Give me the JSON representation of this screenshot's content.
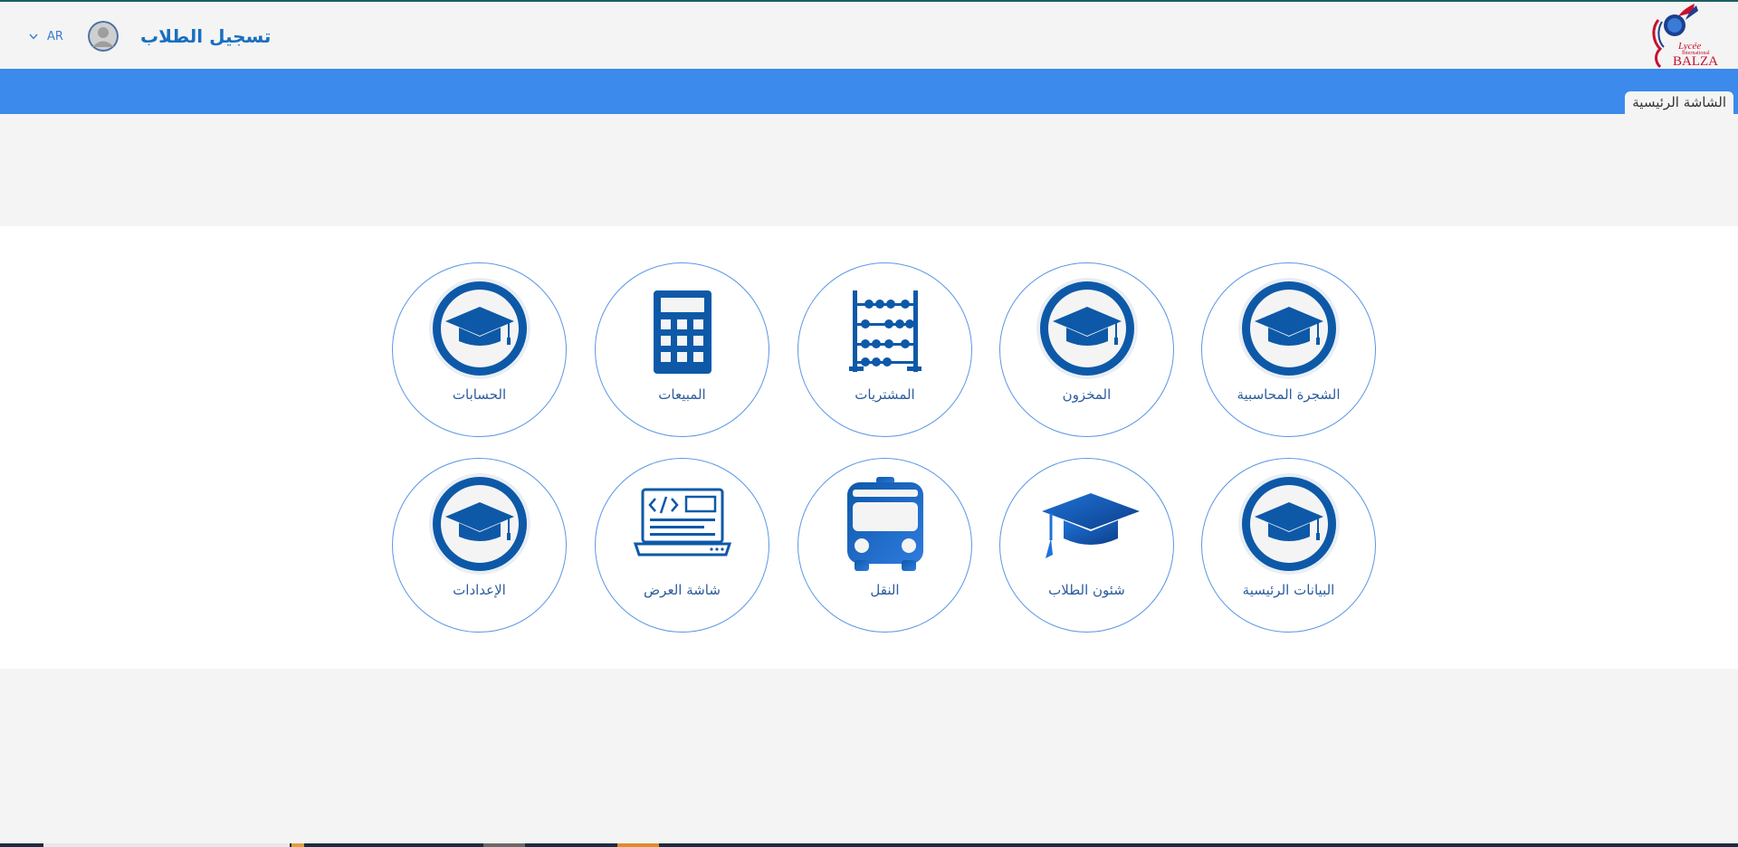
{
  "header": {
    "language": "AR",
    "title": "تسجيل الطلاب",
    "logo_text_top": "Lycée",
    "logo_text_mid": "International",
    "logo_text_main": "BALZAC"
  },
  "nav": {
    "home_tab": "الشاشة الرئيسية"
  },
  "tiles": [
    {
      "label": "الشجرة المحاسبية",
      "icon": "graduation-cap-badge-icon"
    },
    {
      "label": "المخزون",
      "icon": "graduation-cap-badge-icon"
    },
    {
      "label": "المشتريات",
      "icon": "abacus-icon"
    },
    {
      "label": "المبيعات",
      "icon": "calculator-icon"
    },
    {
      "label": "الحسابات",
      "icon": "graduation-cap-badge-icon"
    },
    {
      "label": "البيانات الرئيسية",
      "icon": "graduation-cap-badge-icon"
    },
    {
      "label": "شئون الطلاب",
      "icon": "graduation-cap-icon"
    },
    {
      "label": "النقل",
      "icon": "bus-icon"
    },
    {
      "label": "شاشة العرض",
      "icon": "laptop-code-icon"
    },
    {
      "label": "الإعدادات",
      "icon": "graduation-cap-badge-icon"
    }
  ],
  "colors": {
    "accent_blue": "#3b8aec",
    "icon_blue": "#0d59a8",
    "title_blue": "#1a6fc0"
  }
}
